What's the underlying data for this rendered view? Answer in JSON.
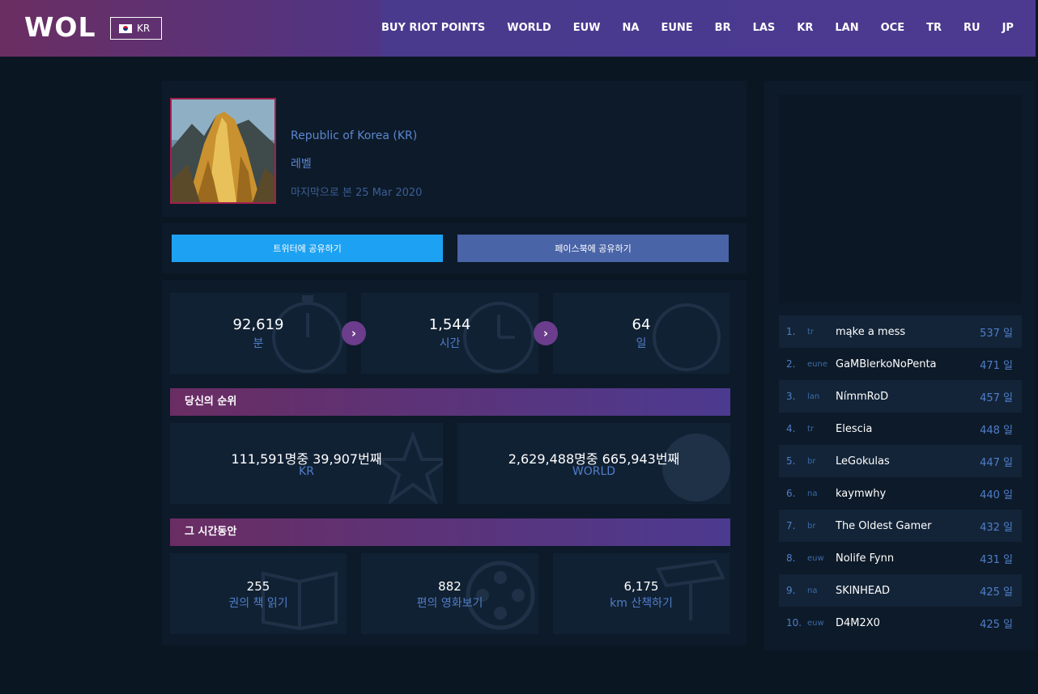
{
  "header": {
    "logo": "WOL",
    "region": "KR",
    "nav": [
      "BUY RIOT POINTS",
      "WORLD",
      "EUW",
      "NA",
      "EUNE",
      "BR",
      "LAS",
      "KR",
      "LAN",
      "OCE",
      "TR",
      "RU",
      "JP"
    ]
  },
  "profile": {
    "region": "Republic of Korea (KR)",
    "level_label": "레벨",
    "last_seen": "마지막으로 본 25 Mar 2020"
  },
  "share": {
    "twitter": "트위터에 공유하기",
    "facebook": "페이스북에 공유하기"
  },
  "time_stats": [
    {
      "value": "92,619",
      "label": "분"
    },
    {
      "value": "1,544",
      "label": "시간"
    },
    {
      "value": "64",
      "label": "일"
    }
  ],
  "rank_section": {
    "title": "당신의 순위",
    "items": [
      {
        "value": "111,591명중 39,907번째",
        "label": "KR"
      },
      {
        "value": "2,629,488명중 665,943번째",
        "label": "WORLD"
      }
    ]
  },
  "meanwhile_section": {
    "title": "그 시간동안",
    "items": [
      {
        "value": "255",
        "label": "권의 책 읽기"
      },
      {
        "value": "882",
        "label": "편의 영화보기"
      },
      {
        "value": "6,175",
        "label": "km 산책하기"
      }
    ]
  },
  "leaderboard": [
    {
      "rank": "1.",
      "region": "tr",
      "name": "mąke a mess",
      "days": "537 일"
    },
    {
      "rank": "2.",
      "region": "eune",
      "name": "GaMBlerkoNoPenta",
      "days": "471 일"
    },
    {
      "rank": "3.",
      "region": "lan",
      "name": "NímmRoD",
      "days": "457 일"
    },
    {
      "rank": "4.",
      "region": "tr",
      "name": "Elescia",
      "days": "448 일"
    },
    {
      "rank": "5.",
      "region": "br",
      "name": "LeGokulas",
      "days": "447 일"
    },
    {
      "rank": "6.",
      "region": "na",
      "name": "kaymwhy",
      "days": "440 일"
    },
    {
      "rank": "7.",
      "region": "br",
      "name": "The Oldest Gamer",
      "days": "432 일"
    },
    {
      "rank": "8.",
      "region": "euw",
      "name": "Nolife Fynn",
      "days": "431 일"
    },
    {
      "rank": "9.",
      "region": "na",
      "name": "SKlNHEAD",
      "days": "425 일"
    },
    {
      "rank": "10.",
      "region": "euw",
      "name": "D4M2X0",
      "days": "425 일"
    }
  ],
  "colors": {
    "accent": "#4f7ec8",
    "twitter": "#1da1f2",
    "facebook": "#4a64a8",
    "avatar_border": "#a0204e"
  }
}
